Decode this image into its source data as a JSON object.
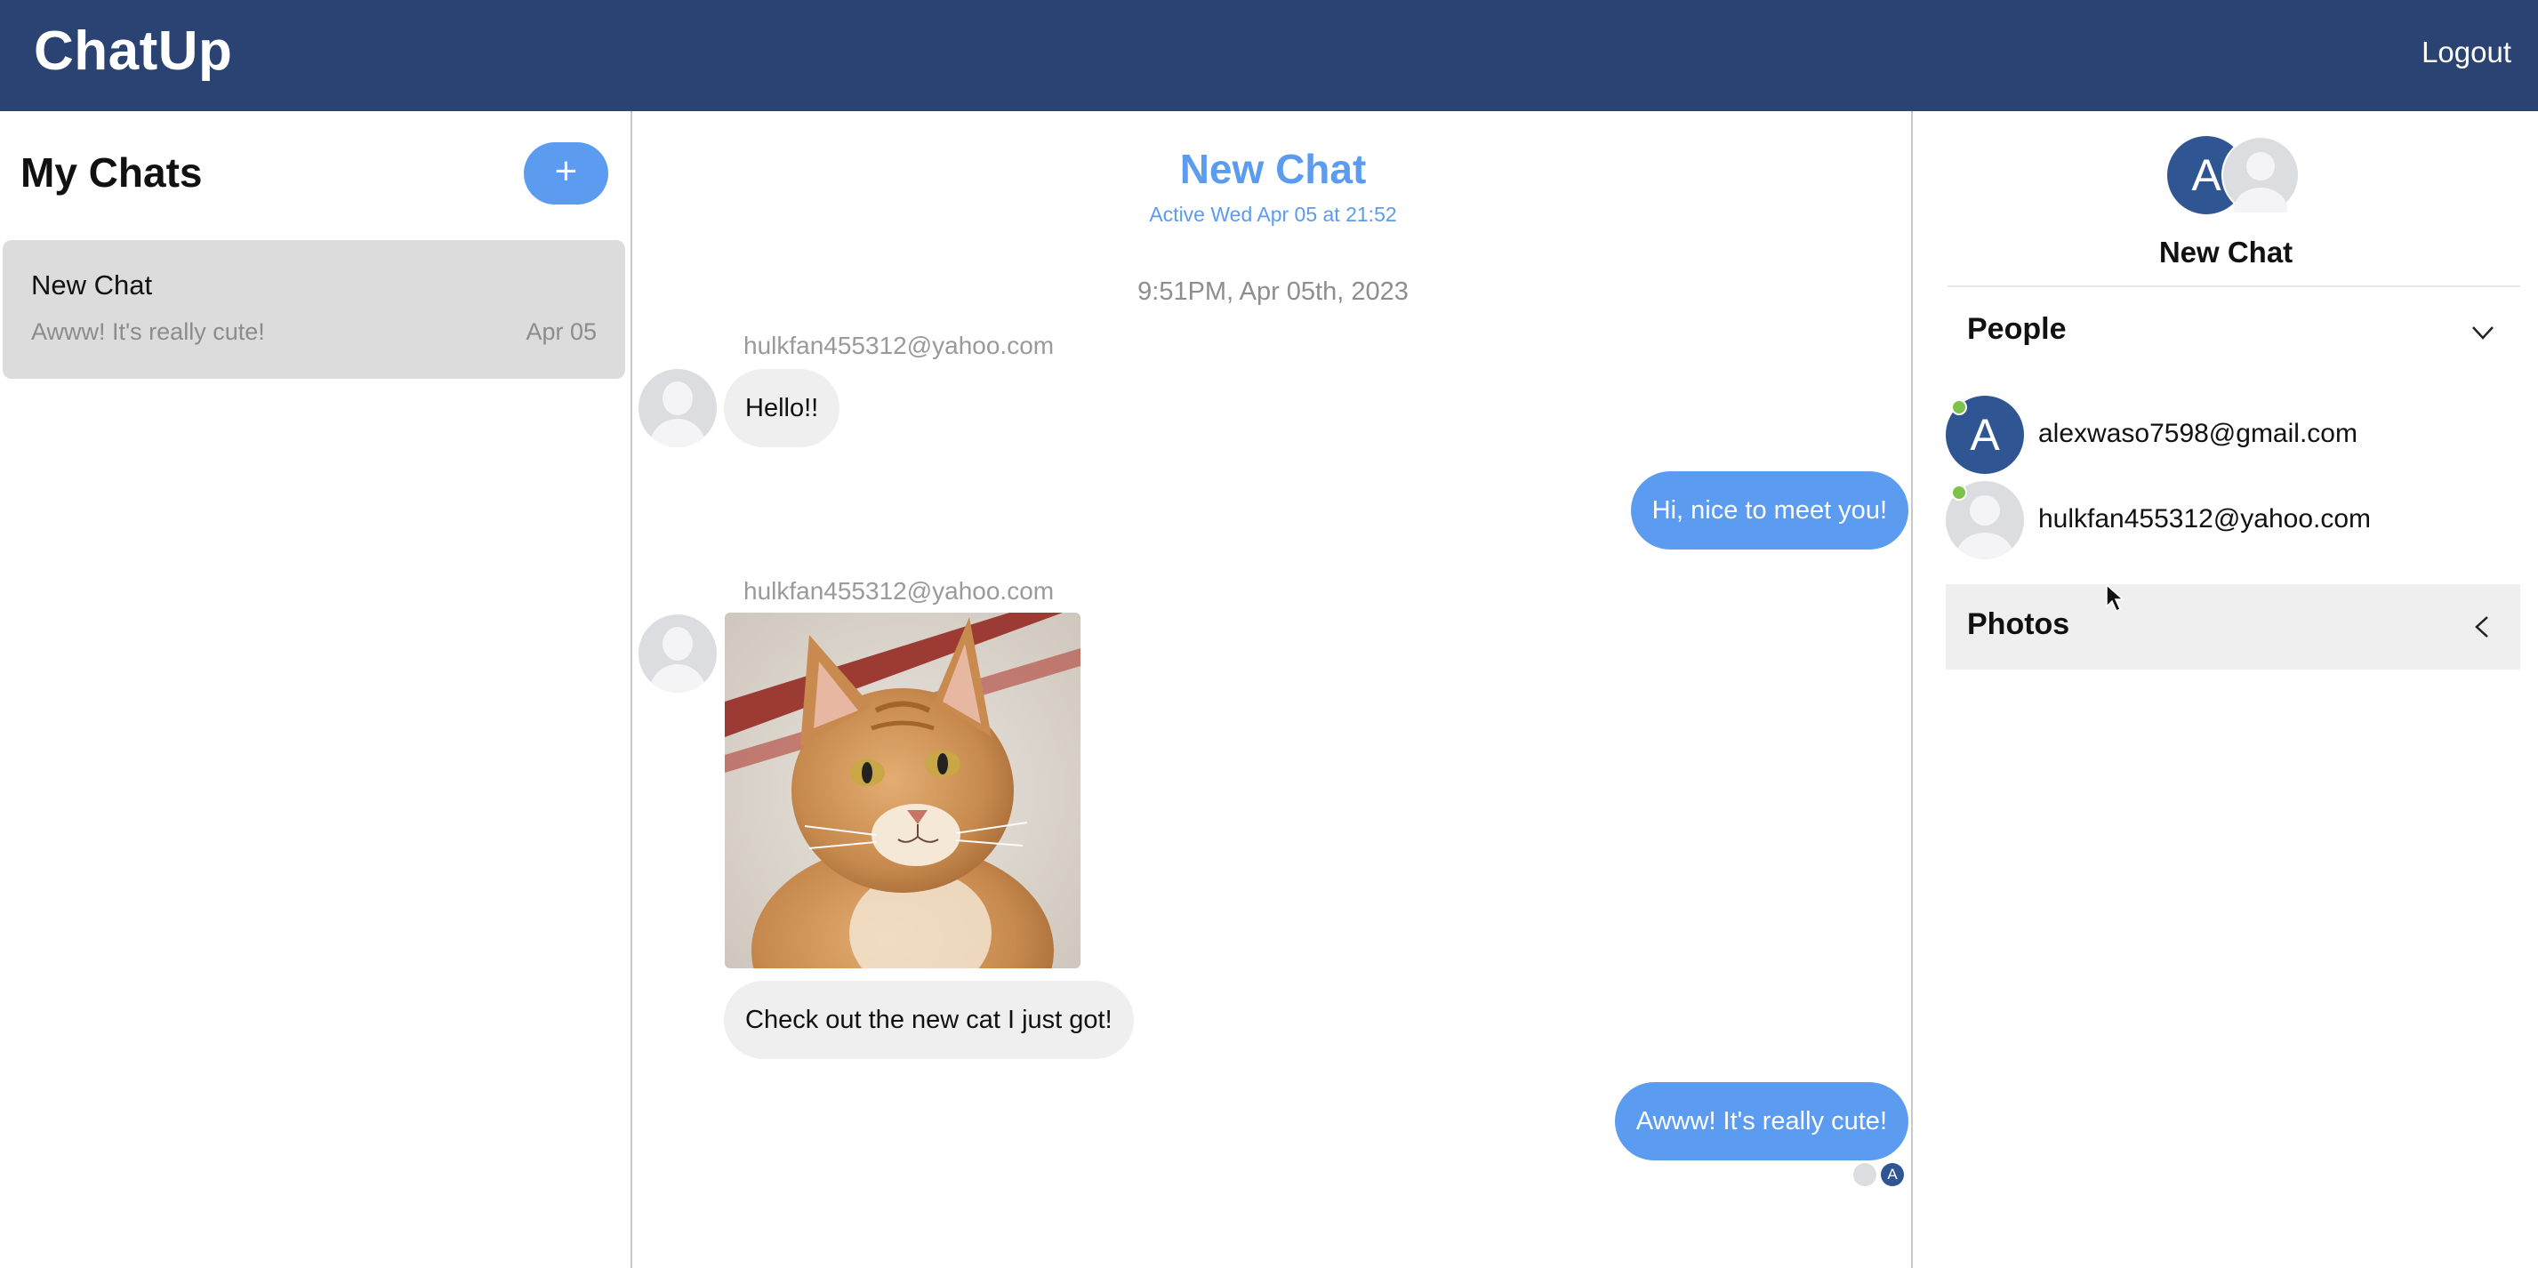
{
  "app": {
    "title": "ChatUp",
    "logout_label": "Logout"
  },
  "sidebar": {
    "title": "My Chats",
    "add_button_label": "+",
    "chats": [
      {
        "name": "New Chat",
        "preview": "Awww! It's really cute!",
        "date": "Apr 05"
      }
    ]
  },
  "conversation": {
    "title": "New Chat",
    "active_status": "Active Wed Apr 05 at 21:52",
    "timestamp": "9:51PM, Apr 05th, 2023",
    "messages": [
      {
        "sender": "hulkfan455312@yahoo.com",
        "text": "Hello!!"
      },
      {
        "text": "Hi, nice to meet you!"
      },
      {
        "sender": "hulkfan455312@yahoo.com",
        "image": "cat-photo",
        "text": "Check out the new cat I just got!"
      },
      {
        "text": "Awww! It's really cute!"
      }
    ],
    "read_receipt_initial": "A"
  },
  "details": {
    "group_avatar_initial": "A",
    "group_name": "New Chat",
    "people_label": "People",
    "people": [
      {
        "initial": "A",
        "email": "alexwaso7598@gmail.com",
        "online": true
      },
      {
        "initial": "",
        "email": "hulkfan455312@yahoo.com",
        "online": true
      }
    ],
    "photos_label": "Photos"
  },
  "colors": {
    "header_bg": "#2b4372",
    "accent_blue": "#5b9bf0",
    "avatar_blue": "#2f5592",
    "online_green": "#7cc24c"
  },
  "icons": [
    "plus-icon",
    "chevron-down-icon",
    "chevron-left-icon",
    "user-placeholder-icon",
    "mouse-cursor-icon"
  ]
}
